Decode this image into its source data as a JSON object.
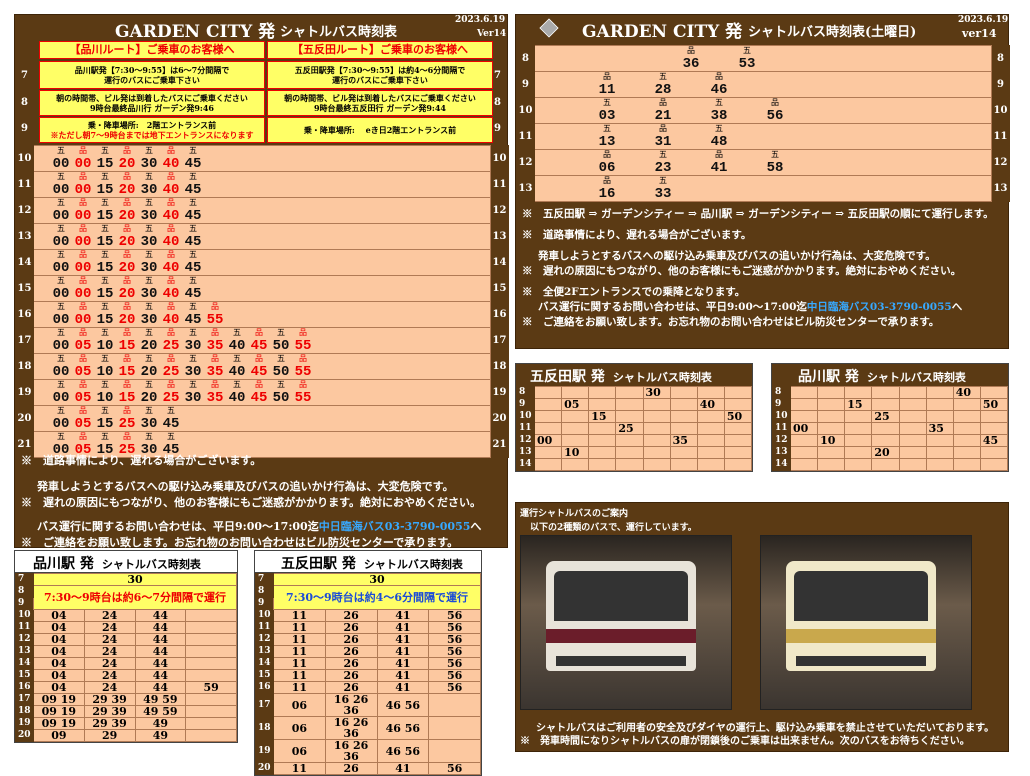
{
  "left": {
    "title_brand": "GARDEN CITY 発",
    "title_sub": "シャトルバス時刻表",
    "date": "2023.6.19",
    "ver": "Ver14",
    "box1_title": "【品川ルート】ご乗車のお客様へ",
    "box2_title": "【五反田ルート】ご乗車のお客様へ",
    "box1_row7a": "品川駅発【7:30～9:55】は6～7分間隔で",
    "box1_row7b": "運行のバスにご乗車下さい",
    "box2_row7a": "五反田駅発【7:30～9:55】は約4～6分間隔で",
    "box2_row7b": "運行のバスにご乗車下さい",
    "box1_row8a": "朝の時間帯、ビル発は到着したバスにご乗車ください",
    "box1_row8b": "9時台最終品川行 ガーデン発9:46",
    "box2_row8a": "朝の時間帯、ビル発は到着したバスにご乗車ください",
    "box2_row8b": "9時台最終五反田行 ガーデン発9:44",
    "box1_row9a": "乗・降車場所:　2階エントランス前",
    "box1_row9b": "※ただし朝7～9時台までは地下エントランスになります",
    "box2_row9": "乗・降車場所:　 eき日2階エントランス前",
    "hours_top": [
      "7",
      "8",
      "9"
    ],
    "rows": [
      {
        "h": "10",
        "k": [
          "五",
          "品",
          "五",
          "品",
          "五",
          "品",
          "五"
        ],
        "m": [
          [
            "00",
            0
          ],
          [
            "00",
            1
          ],
          [
            "15",
            0
          ],
          [
            "20",
            1
          ],
          [
            "30",
            0
          ],
          [
            "40",
            1
          ],
          [
            "45",
            0
          ]
        ]
      },
      {
        "h": "11",
        "k": [
          "五",
          "品",
          "五",
          "品",
          "五",
          "品",
          "五"
        ],
        "m": [
          [
            "00",
            0
          ],
          [
            "00",
            1
          ],
          [
            "15",
            0
          ],
          [
            "20",
            1
          ],
          [
            "30",
            0
          ],
          [
            "40",
            1
          ],
          [
            "45",
            0
          ]
        ]
      },
      {
        "h": "12",
        "k": [
          "五",
          "品",
          "五",
          "品",
          "五",
          "品",
          "五"
        ],
        "m": [
          [
            "00",
            0
          ],
          [
            "00",
            1
          ],
          [
            "15",
            0
          ],
          [
            "20",
            1
          ],
          [
            "30",
            0
          ],
          [
            "40",
            1
          ],
          [
            "45",
            0
          ]
        ]
      },
      {
        "h": "13",
        "k": [
          "五",
          "品",
          "五",
          "品",
          "五",
          "品",
          "五"
        ],
        "m": [
          [
            "00",
            0
          ],
          [
            "00",
            1
          ],
          [
            "15",
            0
          ],
          [
            "20",
            1
          ],
          [
            "30",
            0
          ],
          [
            "40",
            1
          ],
          [
            "45",
            0
          ]
        ]
      },
      {
        "h": "14",
        "k": [
          "五",
          "品",
          "五",
          "品",
          "五",
          "品",
          "五"
        ],
        "m": [
          [
            "00",
            0
          ],
          [
            "00",
            1
          ],
          [
            "15",
            0
          ],
          [
            "20",
            1
          ],
          [
            "30",
            0
          ],
          [
            "40",
            1
          ],
          [
            "45",
            0
          ]
        ]
      },
      {
        "h": "15",
        "k": [
          "五",
          "品",
          "五",
          "品",
          "五",
          "品",
          "五"
        ],
        "m": [
          [
            "00",
            0
          ],
          [
            "00",
            1
          ],
          [
            "15",
            0
          ],
          [
            "20",
            1
          ],
          [
            "30",
            0
          ],
          [
            "40",
            1
          ],
          [
            "45",
            0
          ]
        ]
      },
      {
        "h": "16",
        "k": [
          "五",
          "品",
          "五",
          "品",
          "五",
          "品",
          "五",
          "品"
        ],
        "m": [
          [
            "00",
            0
          ],
          [
            "00",
            1
          ],
          [
            "15",
            0
          ],
          [
            "20",
            1
          ],
          [
            "30",
            0
          ],
          [
            "40",
            1
          ],
          [
            "45",
            0
          ],
          [
            "55",
            1
          ]
        ]
      },
      {
        "h": "17",
        "k": [
          "五",
          "品",
          "五",
          "品",
          "五",
          "品",
          "五",
          "品",
          "五",
          "品",
          "五",
          "品"
        ],
        "m": [
          [
            "00",
            0
          ],
          [
            "05",
            1
          ],
          [
            "10",
            0
          ],
          [
            "15",
            1
          ],
          [
            "20",
            0
          ],
          [
            "25",
            1
          ],
          [
            "30",
            0
          ],
          [
            "35",
            1
          ],
          [
            "40",
            0
          ],
          [
            "45",
            1
          ],
          [
            "50",
            0
          ],
          [
            "55",
            1
          ]
        ]
      },
      {
        "h": "18",
        "k": [
          "五",
          "品",
          "五",
          "品",
          "五",
          "品",
          "五",
          "品",
          "五",
          "品",
          "五",
          "品"
        ],
        "m": [
          [
            "00",
            0
          ],
          [
            "05",
            1
          ],
          [
            "10",
            0
          ],
          [
            "15",
            1
          ],
          [
            "20",
            0
          ],
          [
            "25",
            1
          ],
          [
            "30",
            0
          ],
          [
            "35",
            1
          ],
          [
            "40",
            0
          ],
          [
            "45",
            1
          ],
          [
            "50",
            0
          ],
          [
            "55",
            1
          ]
        ]
      },
      {
        "h": "19",
        "k": [
          "五",
          "品",
          "五",
          "品",
          "五",
          "品",
          "五",
          "品",
          "五",
          "品",
          "五",
          "品"
        ],
        "m": [
          [
            "00",
            0
          ],
          [
            "05",
            1
          ],
          [
            "10",
            0
          ],
          [
            "15",
            1
          ],
          [
            "20",
            0
          ],
          [
            "25",
            1
          ],
          [
            "30",
            0
          ],
          [
            "35",
            1
          ],
          [
            "40",
            0
          ],
          [
            "45",
            1
          ],
          [
            "50",
            0
          ],
          [
            "55",
            1
          ]
        ]
      },
      {
        "h": "20",
        "k": [
          "五",
          "品",
          "五",
          "品",
          "五",
          "五"
        ],
        "m": [
          [
            "00",
            0
          ],
          [
            "05",
            1
          ],
          [
            "15",
            0
          ],
          [
            "25",
            1
          ],
          [
            "30",
            0
          ],
          [
            "45",
            0
          ]
        ]
      },
      {
        "h": "21",
        "k": [
          "五",
          "品",
          "五",
          "品",
          "五",
          "五"
        ],
        "m": [
          [
            "00",
            0
          ],
          [
            "05",
            1
          ],
          [
            "15",
            0
          ],
          [
            "25",
            1
          ],
          [
            "30",
            0
          ],
          [
            "45",
            0
          ]
        ]
      }
    ],
    "note1": "道路事情により、遅れる場合がございます。",
    "note2a": "発車しようとするバスへの駆け込み乗車及びバスの追いかけ行為は、大変危険です。",
    "note2b": "遅れの原因にもつながり、他のお客様にもご迷惑がかかります。絶対におやめください。",
    "note3a": "バス運行に関するお問い合わせは、平日9:00～17:00迄",
    "note3_contact": "中日臨海バス03-3790-0055",
    "note3b": "へ",
    "note3c": "ご連絡をお願い致します。お忘れ物のお問い合わせはビル防災センターで承ります。"
  },
  "right": {
    "title_brand": "GARDEN CITY 発",
    "title_sub": "シャトルバス時刻表(土曜日)",
    "date": "2023.6.19",
    "ver": "ver14",
    "rows": [
      {
        "h": "8",
        "k": [
          "品",
          "五"
        ],
        "m": [
          "36",
          "53"
        ],
        "pos": [
          4,
          6
        ]
      },
      {
        "h": "9",
        "k": [
          "品",
          "五",
          "品"
        ],
        "m": [
          "11",
          "28",
          "46"
        ],
        "pos": [
          1,
          3,
          5
        ]
      },
      {
        "h": "10",
        "k": [
          "五",
          "品",
          "五",
          "品"
        ],
        "m": [
          "03",
          "21",
          "38",
          "56"
        ],
        "pos": [
          1,
          3,
          5,
          7
        ]
      },
      {
        "h": "11",
        "k": [
          "五",
          "品",
          "五"
        ],
        "m": [
          "13",
          "31",
          "48"
        ],
        "pos": [
          1,
          3,
          5
        ]
      },
      {
        "h": "12",
        "k": [
          "品",
          "五",
          "品",
          "五"
        ],
        "m": [
          "06",
          "23",
          "41",
          "58"
        ],
        "pos": [
          1,
          3,
          5,
          7
        ]
      },
      {
        "h": "13",
        "k": [
          "品",
          "五"
        ],
        "m": [
          "16",
          "33"
        ],
        "pos": [
          1,
          3
        ]
      }
    ],
    "note_route": "五反田駅 ⇒ ガーデンシティー ⇒ 品川駅 ⇒ ガーデンシティー ⇒ 五反田駅の順にて運行します。",
    "note1": "道路事情により、遅れる場合がございます。",
    "note2a": "発車しようとするバスへの駆け込み乗車及びバスの追いかけ行為は、大変危険です。",
    "note2b": "遅れの原因にもつながり、他のお客様にもご迷惑がかかります。絶対におやめください。",
    "note3": "全便2Fエントランスでの乗降となります。",
    "note4a": "バス運行に関するお問い合わせは、平日9:00～17:00迄",
    "note4_contact": "中日臨海バス03-3790-0055",
    "note4b": "へ",
    "note4c": "ご連絡をお願い致します。お忘れ物のお問い合わせはビル防災センターで承ります。"
  },
  "gotanda_sat": {
    "title": "五反田駅 発",
    "sub": "シャトルバス時刻表",
    "rows": [
      {
        "h": "8",
        "v": "30",
        "c": 4
      },
      {
        "h": "9",
        "v": "05",
        "c": 1
      },
      {
        "h": "9b",
        "v": "40",
        "c": 6
      },
      {
        "h": "10",
        "v": "15",
        "c": 2
      },
      {
        "h": "10b",
        "v": "50",
        "c": 7
      },
      {
        "h": "11",
        "v": "25",
        "c": 3
      },
      {
        "h": "12",
        "v": "00",
        "c": 0
      },
      {
        "h": "12b",
        "v": "35",
        "c": 5
      },
      {
        "h": "13",
        "v": "10",
        "c": 1
      },
      {
        "h": "14",
        "v": "",
        "c": 0
      }
    ]
  },
  "shinagawa_sat": {
    "title": "品川駅 発",
    "sub": "シャトルバス時刻表",
    "rows": [
      {
        "h": "8",
        "v": "40",
        "c": 6
      },
      {
        "h": "9",
        "v": "15",
        "c": 2
      },
      {
        "h": "9b",
        "v": "50",
        "c": 7
      },
      {
        "h": "10",
        "v": "25",
        "c": 3
      },
      {
        "h": "11",
        "v": "00",
        "c": 0
      },
      {
        "h": "11b",
        "v": "35",
        "c": 5
      },
      {
        "h": "12",
        "v": "10",
        "c": 1
      },
      {
        "h": "12b",
        "v": "45",
        "c": 7
      },
      {
        "h": "13",
        "v": "20",
        "c": 3
      },
      {
        "h": "14",
        "v": "",
        "c": 0
      }
    ]
  },
  "shinagawa_wk": {
    "title": "品川駅 発",
    "sub": "シャトルバス時刻表",
    "first": "30",
    "notice": "7:30～9時台は約6～7分間隔で運行",
    "rows": [
      [
        "10",
        "04",
        "24",
        "44",
        ""
      ],
      [
        "11",
        "04",
        "24",
        "44",
        ""
      ],
      [
        "12",
        "04",
        "24",
        "44",
        ""
      ],
      [
        "13",
        "04",
        "24",
        "44",
        ""
      ],
      [
        "14",
        "04",
        "24",
        "44",
        ""
      ],
      [
        "15",
        "04",
        "24",
        "44",
        ""
      ],
      [
        "16",
        "04",
        "24",
        "44",
        "59"
      ],
      [
        "17",
        "09 19",
        "29 39",
        "49 59",
        ""
      ],
      [
        "18",
        "09 19",
        "29 39",
        "49 59",
        ""
      ],
      [
        "19",
        "09 19",
        "29 39",
        "49",
        ""
      ],
      [
        "20",
        "09",
        "29",
        "49",
        ""
      ]
    ]
  },
  "gotanda_wk": {
    "title": "五反田駅 発",
    "sub": "シャトルバス時刻表",
    "first": "30",
    "notice": "7:30～9時台は約4～6分間隔で運行",
    "rows": [
      [
        "10",
        "11",
        "26",
        "41",
        "56"
      ],
      [
        "11",
        "11",
        "26",
        "41",
        "56"
      ],
      [
        "12",
        "11",
        "26",
        "41",
        "56"
      ],
      [
        "13",
        "11",
        "26",
        "41",
        "56"
      ],
      [
        "14",
        "11",
        "26",
        "41",
        "56"
      ],
      [
        "15",
        "11",
        "26",
        "41",
        "56"
      ],
      [
        "16",
        "11",
        "26",
        "41",
        "56"
      ],
      [
        "17",
        "06",
        "16 26 36",
        "46 56",
        ""
      ],
      [
        "18",
        "06",
        "16 26 36",
        "46 56",
        ""
      ],
      [
        "19",
        "06",
        "16 26 36",
        "46 56",
        ""
      ],
      [
        "20",
        "11",
        "26",
        "41",
        "56"
      ]
    ]
  },
  "bus_info": {
    "title": "運行シャトルバスのご案内",
    "sub": "以下の2種類のバスで、運行しています。",
    "note1": "シャトルバスはご利用者の安全及びダイヤの運行上、駆け込み乗車を禁止させていただいております。",
    "note2": "発車時間になりシャトルバスの扉が閉鎖後のご乗車は出来ません。次のバスをお待ちください。"
  },
  "star": "※"
}
